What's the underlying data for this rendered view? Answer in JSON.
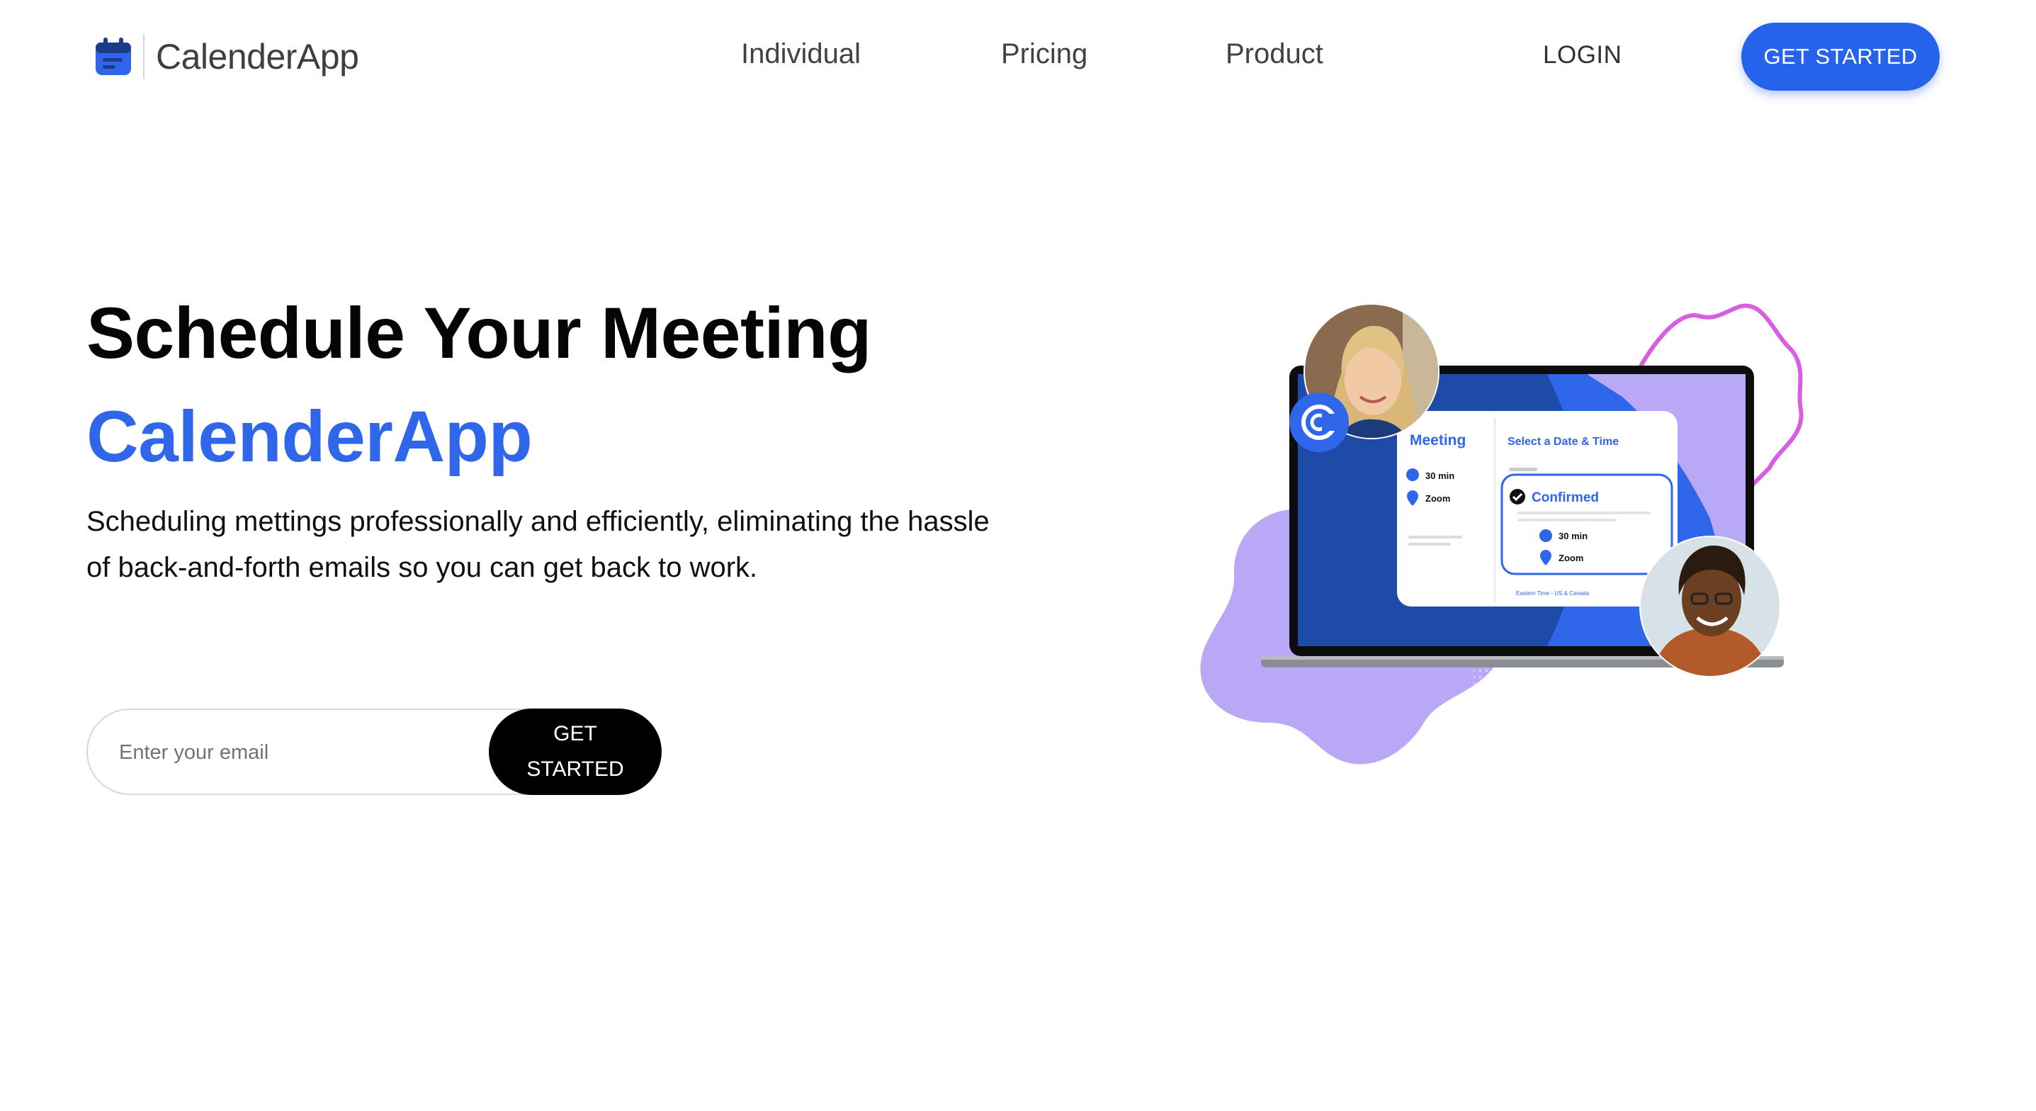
{
  "brand": {
    "name": "CalenderApp",
    "icon": "calendar-icon",
    "color": "#2563eb"
  },
  "nav": {
    "links": [
      "Individual",
      "Pricing",
      "Product"
    ],
    "login": "LOGIN",
    "cta": "GET STARTED"
  },
  "hero": {
    "title": "Schedule Your Meeting",
    "brand_line": "CalenderApp",
    "description": "Scheduling mettings professionally and efficiently, eliminating the hassle of back-and-forth emails so you can get back to work.",
    "email_placeholder": "Enter your email",
    "cta": "GET STARTED"
  },
  "illustration": {
    "card": {
      "meeting_title": "Meeting",
      "select_title": "Select a Date & Time",
      "duration": "30 min",
      "location": "Zoom",
      "confirmed": "Confirmed",
      "timezone": "Eastern Time - US & Canada"
    },
    "colors": {
      "primary": "#2f66ea",
      "dark_blue": "#1e4aa8",
      "lavender": "#b9a8f5",
      "pink_outline": "#d75ee0"
    }
  }
}
